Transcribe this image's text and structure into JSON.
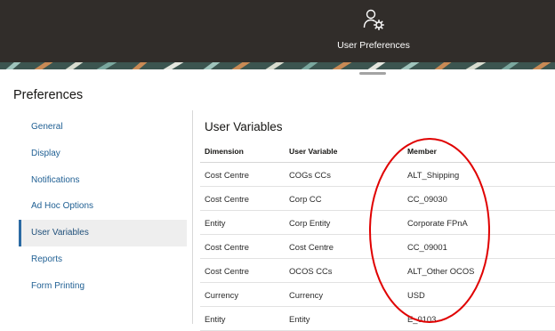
{
  "header": {
    "user_preferences_label": "User Preferences",
    "icon": "user-gear-icon"
  },
  "colors": {
    "topbar": "#312d2a",
    "link": "#1f5f93",
    "active_bg": "#eeeeee",
    "highlight_oval": "#e00000"
  },
  "preferences": {
    "title": "Preferences",
    "nav": [
      {
        "label": "General"
      },
      {
        "label": "Display"
      },
      {
        "label": "Notifications"
      },
      {
        "label": "Ad Hoc Options"
      },
      {
        "label": "User Variables",
        "active": true
      },
      {
        "label": "Reports"
      },
      {
        "label": "Form Printing"
      }
    ]
  },
  "user_variables": {
    "title": "User Variables",
    "columns": [
      "Dimension",
      "User Variable",
      "Member"
    ],
    "rows": [
      [
        "Cost Centre",
        "COGs CCs",
        "ALT_Shipping"
      ],
      [
        "Cost Centre",
        "Corp CC",
        "CC_09030"
      ],
      [
        "Entity",
        "Corp Entity",
        "Corporate FPnA"
      ],
      [
        "Cost Centre",
        "Cost Centre",
        "CC_09001"
      ],
      [
        "Cost Centre",
        "OCOS CCs",
        "ALT_Other OCOS"
      ],
      [
        "Currency",
        "Currency",
        "USD"
      ],
      [
        "Entity",
        "Entity",
        "E_0103"
      ]
    ]
  }
}
